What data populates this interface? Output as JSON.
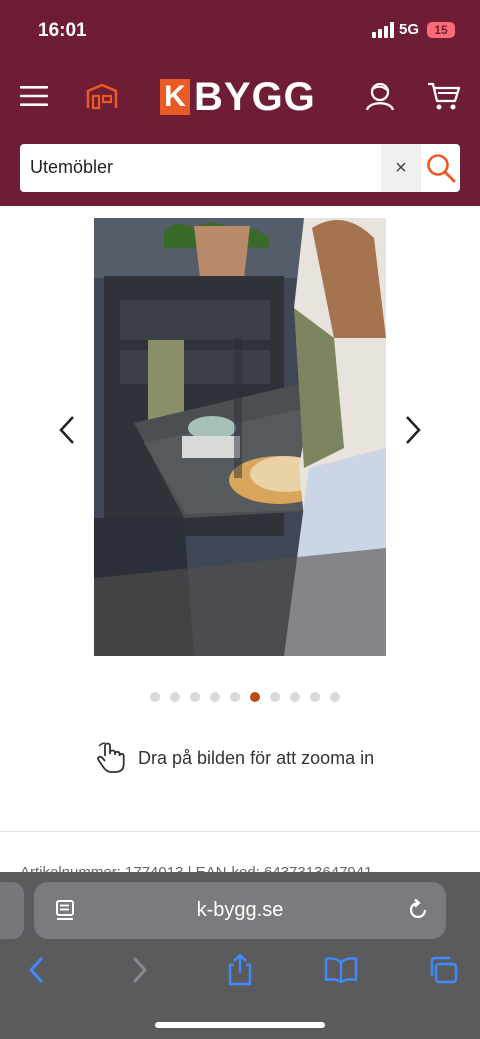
{
  "status_bar": {
    "time": "16:01",
    "network": "5G",
    "battery": "15"
  },
  "header": {
    "logo_k": "K",
    "logo_word": "BYGG",
    "icons": [
      "menu-icon",
      "store-icon",
      "account-icon",
      "cart-icon"
    ]
  },
  "search": {
    "value": "Utemöbler",
    "clear_label": "×"
  },
  "gallery": {
    "image_count": 10,
    "active_index": 5,
    "zoom_hint": "Dra på bilden för att zooma in"
  },
  "details_peek": "Artikelnummer: 1774013 | EAN-kod: 6437313647941",
  "browser": {
    "url": "k-bygg.se"
  },
  "colors": {
    "brand": "#6e1d34",
    "accent": "#ea5a24",
    "active_dot": "#b84a12",
    "safari_link": "#3d8bff"
  }
}
